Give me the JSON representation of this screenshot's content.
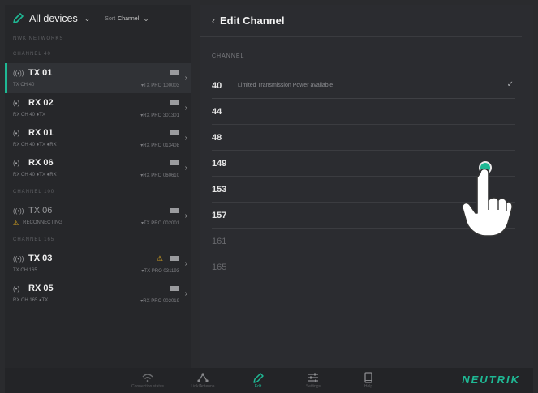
{
  "sidebar": {
    "filter_label": "All devices",
    "sort_label": "Sort",
    "sort_value": "Channel",
    "section_title": "NWK NETWORKS",
    "groups": [
      {
        "title": "CHANNEL 40",
        "devices": [
          {
            "name": "TX 01",
            "type": "tx",
            "line2_left": "TX  CH 40",
            "line2_right": "▾TX PRO 100003",
            "selected": true
          },
          {
            "name": "RX 02",
            "type": "rx",
            "line2_left": "RX  CH 40   ●TX",
            "line2_right": "▾RX PRO 301301"
          },
          {
            "name": "RX 01",
            "type": "rx",
            "line2_left": "RX  CH 40   ●TX ●RX",
            "line2_right": "▾RX PRO 013408"
          },
          {
            "name": "RX 06",
            "type": "rx",
            "line2_left": "RX  CH 40   ●TX ●RX",
            "line2_right": "▾RX PRO 060610"
          }
        ]
      },
      {
        "title": "CHANNEL 100",
        "devices": [
          {
            "name": "TX 06",
            "type": "tx",
            "line2_left": "RECONNECTING",
            "line2_right": "▾TX PRO 002001",
            "dim": true,
            "warn": true
          }
        ]
      },
      {
        "title": "CHANNEL 165",
        "devices": [
          {
            "name": "TX 03",
            "type": "tx",
            "line2_left": "TX  CH 165",
            "line2_right": "▾TX PRO 031193",
            "warn_icon": true
          },
          {
            "name": "RX 05",
            "type": "rx",
            "line2_left": "RX  CH 165  ●TX",
            "line2_right": "▾RX PRO 002019"
          }
        ]
      }
    ]
  },
  "panel": {
    "back_label": "Edit Channel",
    "section_label": "CHANNEL",
    "channels": [
      {
        "number": "40",
        "note": "Limited Transmission Power available",
        "selected": true
      },
      {
        "number": "44"
      },
      {
        "number": "48"
      },
      {
        "number": "149"
      },
      {
        "number": "153"
      },
      {
        "number": "157"
      },
      {
        "number": "161",
        "disabled": true
      },
      {
        "number": "165",
        "disabled": true
      }
    ]
  },
  "navbar": {
    "items": [
      {
        "label": "Connection status",
        "icon": "wifi-icon"
      },
      {
        "label": "Link/Antenna",
        "icon": "network-icon"
      },
      {
        "label": "Edit",
        "icon": "pen-icon",
        "active": true
      },
      {
        "label": "Settings",
        "icon": "sliders-icon"
      },
      {
        "label": "Help",
        "icon": "tablet-icon"
      }
    ],
    "logo": "NEUTRIK"
  },
  "colors": {
    "accent": "#1fb894",
    "background": "#2a2b2e",
    "warning": "#e8b020"
  }
}
